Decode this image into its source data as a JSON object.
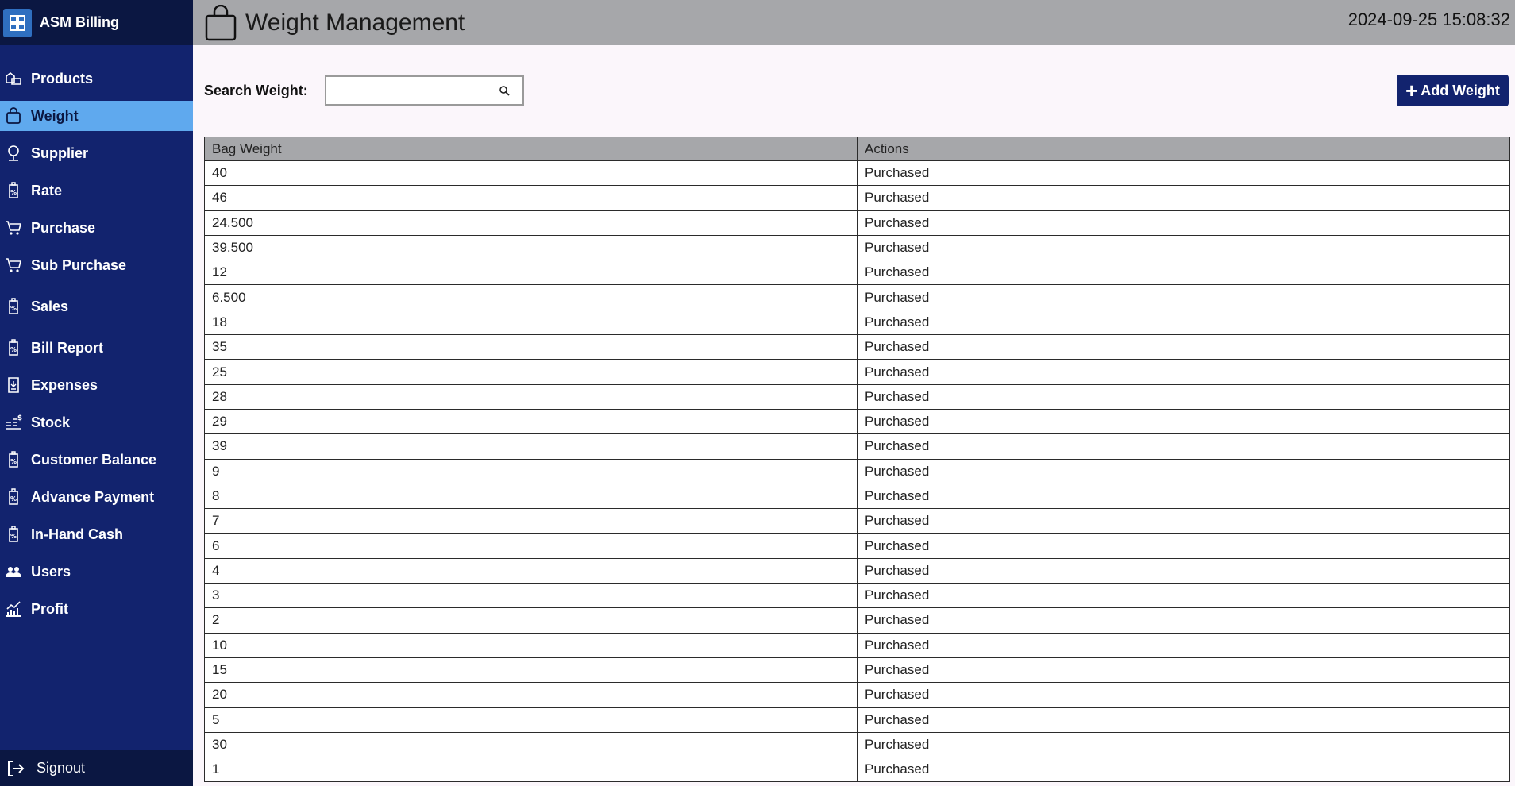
{
  "app": {
    "title": "ASM Billing"
  },
  "sidebar": {
    "items": [
      {
        "label": "Products",
        "icon": "products-icon",
        "active": false
      },
      {
        "label": "Weight",
        "icon": "bag-icon",
        "active": true
      },
      {
        "label": "Supplier",
        "icon": "supplier-icon",
        "active": false
      },
      {
        "label": "Rate",
        "icon": "tag-icon",
        "active": false
      },
      {
        "label": "Purchase",
        "icon": "cart-icon",
        "active": false
      },
      {
        "label": "Sub Purchase",
        "icon": "cart-icon",
        "active": false
      },
      {
        "label": "Sales",
        "icon": "tag-icon",
        "active": false
      },
      {
        "label": "Bill Report",
        "icon": "tag-icon",
        "active": false
      },
      {
        "label": "Expenses",
        "icon": "receipt-icon",
        "active": false
      },
      {
        "label": "Stock",
        "icon": "stock-icon",
        "active": false
      },
      {
        "label": "Customer Balance",
        "icon": "tag-icon",
        "active": false
      },
      {
        "label": "Advance Payment",
        "icon": "tag-icon",
        "active": false
      },
      {
        "label": "In-Hand Cash",
        "icon": "tag-icon",
        "active": false
      },
      {
        "label": "Users",
        "icon": "users-icon",
        "active": false
      },
      {
        "label": "Profit",
        "icon": "chart-icon",
        "active": false
      }
    ],
    "signout_label": "Signout"
  },
  "header": {
    "title": "Weight Management",
    "datetime": "2024-09-25 15:08:32"
  },
  "search": {
    "label": "Search Weight:",
    "value": "",
    "placeholder": ""
  },
  "add_button": {
    "label": "Add Weight"
  },
  "table": {
    "columns": [
      "Bag Weight",
      "Actions"
    ],
    "rows": [
      [
        "40",
        "Purchased"
      ],
      [
        "46",
        "Purchased"
      ],
      [
        "24.500",
        "Purchased"
      ],
      [
        "39.500",
        "Purchased"
      ],
      [
        "12",
        "Purchased"
      ],
      [
        "6.500",
        "Purchased"
      ],
      [
        "18",
        "Purchased"
      ],
      [
        "35",
        "Purchased"
      ],
      [
        "25",
        "Purchased"
      ],
      [
        "28",
        "Purchased"
      ],
      [
        "29",
        "Purchased"
      ],
      [
        "39",
        "Purchased"
      ],
      [
        "9",
        "Purchased"
      ],
      [
        "8",
        "Purchased"
      ],
      [
        "7",
        "Purchased"
      ],
      [
        "6",
        "Purchased"
      ],
      [
        "4",
        "Purchased"
      ],
      [
        "3",
        "Purchased"
      ],
      [
        "2",
        "Purchased"
      ],
      [
        "10",
        "Purchased"
      ],
      [
        "15",
        "Purchased"
      ],
      [
        "20",
        "Purchased"
      ],
      [
        "5",
        "Purchased"
      ],
      [
        "30",
        "Purchased"
      ],
      [
        "1",
        "Purchased"
      ]
    ]
  },
  "colors": {
    "sidebar_bg": "#12236e",
    "sidebar_active": "#5fa9ee",
    "header_bg": "#a6a7aa",
    "button_bg": "#12236e"
  }
}
